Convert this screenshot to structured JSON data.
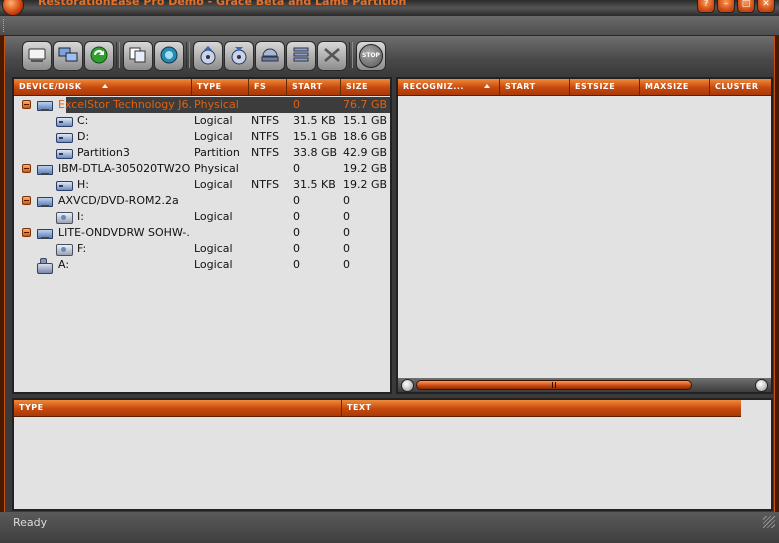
{
  "window": {
    "title": "RestorationEase Pro Demo - Grace Beta and Lame Partition",
    "controls": [
      "?",
      "–",
      "□",
      "✕"
    ]
  },
  "toolbar": {
    "buttons": [
      {
        "name": "open-disk-button",
        "icon": "drive-icon"
      },
      {
        "name": "network-button",
        "icon": "network-icon"
      },
      {
        "name": "refresh-button",
        "icon": "refresh-icon"
      },
      {
        "name": "copy-button",
        "icon": "copy-icon"
      },
      {
        "name": "scan-button",
        "icon": "scan-icon"
      },
      {
        "name": "recover-button",
        "icon": "disk-up-icon"
      },
      {
        "name": "save-button",
        "icon": "disk-down-icon"
      },
      {
        "name": "eject-button",
        "icon": "eject-icon"
      },
      {
        "name": "list-button",
        "icon": "list-icon"
      },
      {
        "name": "tools-button",
        "icon": "tools-icon"
      },
      {
        "name": "stop-button",
        "icon": "stop-icon",
        "label": "STOP"
      }
    ]
  },
  "devices": {
    "columns": [
      "DEVICE/DISK",
      "TYPE",
      "FS",
      "START",
      "SIZE"
    ],
    "rows": [
      {
        "kind": "disk",
        "expander": true,
        "name": "ExcelStor Technology J6...",
        "type": "Physical",
        "fs": "",
        "start": "0",
        "size": "76.7 GB",
        "selected": true
      },
      {
        "kind": "volume",
        "expander": false,
        "name": "C:",
        "type": "Logical",
        "fs": "NTFS",
        "start": "31.5 KB",
        "size": "15.1 GB"
      },
      {
        "kind": "volume",
        "expander": false,
        "name": "D:",
        "type": "Logical",
        "fs": "NTFS",
        "start": "15.1 GB",
        "size": "18.6 GB"
      },
      {
        "kind": "volume",
        "expander": false,
        "name": "Partition3",
        "type": "Partition",
        "fs": "NTFS",
        "start": "33.8 GB",
        "size": "42.9 GB"
      },
      {
        "kind": "disk",
        "expander": true,
        "name": "IBM-DTLA-305020TW2O...",
        "type": "Physical",
        "fs": "",
        "start": "0",
        "size": "19.2 GB"
      },
      {
        "kind": "volume",
        "expander": false,
        "name": "H:",
        "type": "Logical",
        "fs": "NTFS",
        "start": "31.5 KB",
        "size": "19.2 GB"
      },
      {
        "kind": "disk",
        "expander": true,
        "name": "AXVCD/DVD-ROM2.2a",
        "type": "",
        "fs": "",
        "start": "0",
        "size": "0"
      },
      {
        "kind": "cd",
        "expander": false,
        "name": "I:",
        "type": "Logical",
        "fs": "",
        "start": "0",
        "size": "0"
      },
      {
        "kind": "disk",
        "expander": true,
        "name": "LITE-ONDVDRW SOHW-...",
        "type": "",
        "fs": "",
        "start": "0",
        "size": "0"
      },
      {
        "kind": "cd",
        "expander": false,
        "name": "F:",
        "type": "Logical",
        "fs": "",
        "start": "0",
        "size": "0"
      },
      {
        "kind": "floppy",
        "expander": false,
        "name": "A:",
        "type": "Logical",
        "fs": "",
        "start": "0",
        "size": "0"
      }
    ]
  },
  "recognized": {
    "columns": [
      "RECOGNIZ...",
      "START",
      "ESTSIZE",
      "MAXSIZE",
      "CLUSTER"
    ],
    "scroll_position": 0.5
  },
  "log": {
    "columns": [
      "TYPE",
      "TEXT"
    ]
  },
  "status": {
    "text": "Ready"
  },
  "colors": {
    "accent": "#d8540e",
    "selected_text": "#e06010",
    "panel_bg": "#e2e2e2"
  }
}
